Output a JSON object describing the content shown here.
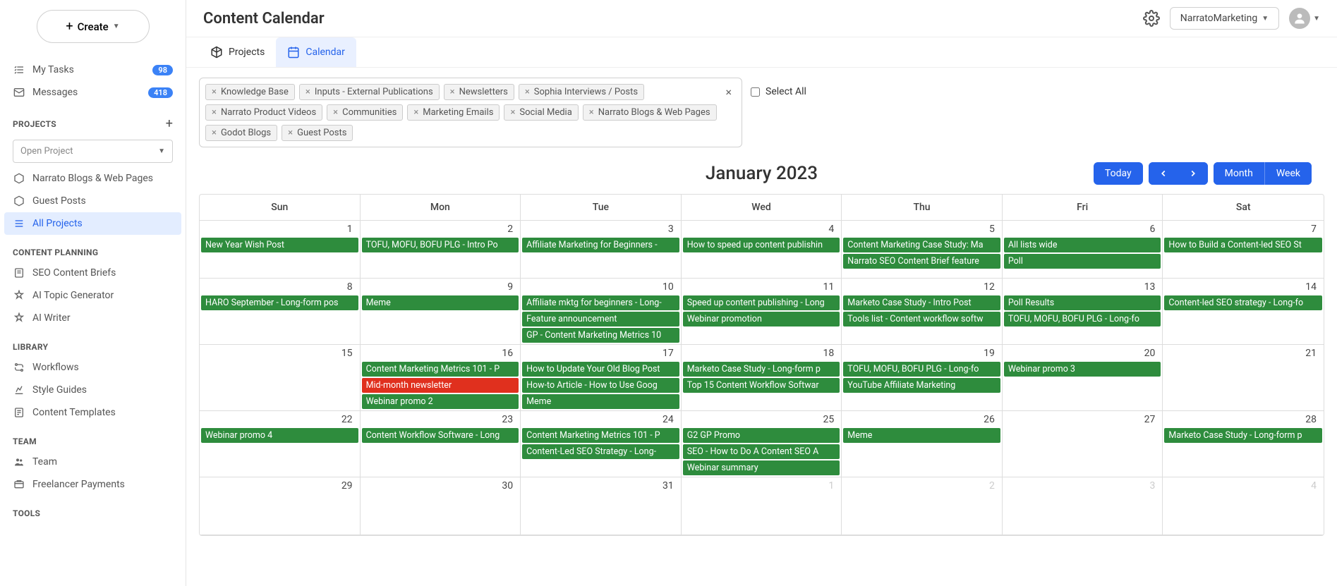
{
  "header": {
    "title": "Content Calendar",
    "workspace": "NarratoMarketing"
  },
  "create_label": "Create",
  "sidebar": {
    "my_tasks": {
      "label": "My Tasks",
      "count": "98"
    },
    "messages": {
      "label": "Messages",
      "count": "418"
    },
    "sections": {
      "projects": "PROJECTS",
      "planning": "CONTENT PLANNING",
      "library": "LIBRARY",
      "team": "TEAM",
      "tools": "TOOLS"
    },
    "open_project": "Open Project",
    "projects": [
      {
        "label": "Narrato Blogs & Web Pages"
      },
      {
        "label": "Guest Posts"
      },
      {
        "label": "All Projects",
        "active": true
      }
    ],
    "planning": [
      {
        "label": "SEO Content Briefs"
      },
      {
        "label": "AI Topic Generator"
      },
      {
        "label": "AI Writer"
      }
    ],
    "library": [
      {
        "label": "Workflows"
      },
      {
        "label": "Style Guides"
      },
      {
        "label": "Content Templates"
      }
    ],
    "team": [
      {
        "label": "Team"
      },
      {
        "label": "Freelancer Payments"
      }
    ]
  },
  "tabs": {
    "projects": "Projects",
    "calendar": "Calendar"
  },
  "filters": {
    "chips": [
      "Knowledge Base",
      "Inputs - External Publications",
      "Newsletters",
      "Sophia Interviews / Posts",
      "Narrato Product Videos",
      "Communities",
      "Marketing Emails",
      "Social Media",
      "Narrato Blogs & Web Pages",
      "Godot Blogs",
      "Guest Posts"
    ],
    "select_all": "Select All"
  },
  "calendar": {
    "title": "January 2023",
    "today": "Today",
    "month": "Month",
    "week": "Week",
    "days": [
      "Sun",
      "Mon",
      "Tue",
      "Wed",
      "Thu",
      "Fri",
      "Sat"
    ],
    "weeks": [
      [
        {
          "d": "1",
          "ev": [
            {
              "t": "New Year Wish Post"
            }
          ]
        },
        {
          "d": "2",
          "ev": [
            {
              "t": "TOFU, MOFU, BOFU PLG - Intro Po"
            }
          ]
        },
        {
          "d": "3",
          "ev": [
            {
              "t": "Affiliate Marketing for Beginners -"
            }
          ]
        },
        {
          "d": "4",
          "ev": [
            {
              "t": "How to speed up content publishin"
            }
          ]
        },
        {
          "d": "5",
          "ev": [
            {
              "t": "Content Marketing Case Study: Ma"
            },
            {
              "t": "Narrato SEO Content Brief feature"
            }
          ]
        },
        {
          "d": "6",
          "ev": [
            {
              "t": "All lists wide"
            },
            {
              "t": "Poll"
            }
          ]
        },
        {
          "d": "7",
          "ev": [
            {
              "t": "How to Build a Content-led SEO St"
            }
          ]
        }
      ],
      [
        {
          "d": "8",
          "ev": [
            {
              "t": "HARO September - Long-form pos"
            }
          ]
        },
        {
          "d": "9",
          "ev": [
            {
              "t": "Meme"
            }
          ]
        },
        {
          "d": "10",
          "ev": [
            {
              "t": "Affiliate mktg for beginners - Long-"
            },
            {
              "t": "Feature announcement"
            },
            {
              "t": "GP - Content Marketing Metrics 10"
            }
          ]
        },
        {
          "d": "11",
          "ev": [
            {
              "t": "Speed up content publishing - Long"
            },
            {
              "t": "Webinar promotion"
            }
          ]
        },
        {
          "d": "12",
          "ev": [
            {
              "t": "Marketo Case Study - Intro Post"
            },
            {
              "t": "Tools list - Content workflow softw"
            }
          ]
        },
        {
          "d": "13",
          "ev": [
            {
              "t": "Poll Results"
            },
            {
              "t": "TOFU, MOFU, BOFU PLG - Long-fo"
            }
          ]
        },
        {
          "d": "14",
          "ev": [
            {
              "t": "Content-led SEO strategy - Long-fo"
            }
          ]
        }
      ],
      [
        {
          "d": "15",
          "ev": []
        },
        {
          "d": "16",
          "ev": [
            {
              "t": "Content Marketing Metrics 101 - P"
            },
            {
              "t": "Mid-month newsletter",
              "c": "red"
            },
            {
              "t": "Webinar promo 2"
            }
          ]
        },
        {
          "d": "17",
          "ev": [
            {
              "t": "How to Update Your Old Blog Post"
            },
            {
              "t": "How-to Article - How to Use Goog"
            },
            {
              "t": "Meme"
            }
          ]
        },
        {
          "d": "18",
          "ev": [
            {
              "t": "Marketo Case Study - Long-form p"
            },
            {
              "t": "Top 15 Content Workflow Softwar"
            }
          ]
        },
        {
          "d": "19",
          "ev": [
            {
              "t": "TOFU, MOFU, BOFU PLG - Long-fo"
            },
            {
              "t": "YouTube Affiliate Marketing"
            }
          ]
        },
        {
          "d": "20",
          "ev": [
            {
              "t": "Webinar promo 3"
            }
          ]
        },
        {
          "d": "21",
          "ev": []
        }
      ],
      [
        {
          "d": "22",
          "ev": [
            {
              "t": "Webinar promo 4"
            }
          ]
        },
        {
          "d": "23",
          "ev": [
            {
              "t": "Content Workflow Software - Long"
            }
          ]
        },
        {
          "d": "24",
          "ev": [
            {
              "t": "Content Marketing Metrics 101 - P"
            },
            {
              "t": "Content-Led SEO Strategy - Long-"
            }
          ]
        },
        {
          "d": "25",
          "ev": [
            {
              "t": "G2 GP Promo"
            },
            {
              "t": "SEO - How to Do A Content SEO A"
            },
            {
              "t": "Webinar summary"
            }
          ]
        },
        {
          "d": "26",
          "ev": [
            {
              "t": "Meme"
            }
          ]
        },
        {
          "d": "27",
          "ev": []
        },
        {
          "d": "28",
          "ev": [
            {
              "t": "Marketo Case Study - Long-form p"
            }
          ]
        }
      ],
      [
        {
          "d": "29",
          "ev": []
        },
        {
          "d": "30",
          "ev": []
        },
        {
          "d": "31",
          "ev": []
        },
        {
          "d": "1",
          "dim": true,
          "ev": []
        },
        {
          "d": "2",
          "dim": true,
          "ev": []
        },
        {
          "d": "3",
          "dim": true,
          "ev": []
        },
        {
          "d": "4",
          "dim": true,
          "ev": []
        }
      ]
    ]
  }
}
